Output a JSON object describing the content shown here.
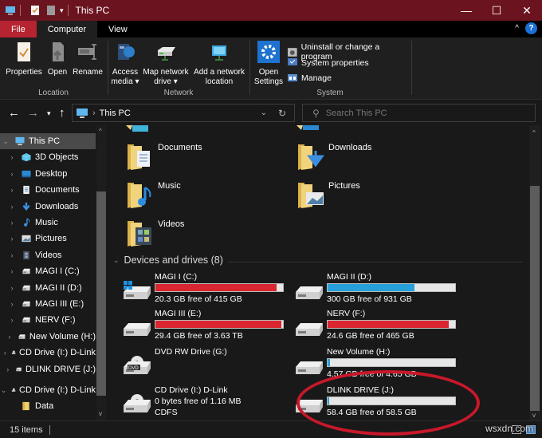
{
  "window": {
    "title": "This PC",
    "controls": {
      "minimize": "—",
      "maximize": "☐",
      "close": "✕"
    }
  },
  "ribbon_tabs": [
    {
      "label": "File"
    },
    {
      "label": "Computer",
      "active": true
    },
    {
      "label": "View"
    }
  ],
  "ribbon": {
    "groups": {
      "location": {
        "label": "Location",
        "buttons": [
          {
            "label": "Properties",
            "icon": "properties-icon"
          },
          {
            "label": "Open",
            "icon": "open-icon"
          },
          {
            "label": "Rename",
            "icon": "rename-icon"
          }
        ]
      },
      "network": {
        "label": "Network",
        "buttons": [
          {
            "label": "Access",
            "label2": "media ▾",
            "icon": "access-media-icon"
          },
          {
            "label": "Map network",
            "label2": "drive ▾",
            "icon": "map-network-drive-icon"
          },
          {
            "label": "Add a network",
            "label2": "location",
            "icon": "add-network-location-icon"
          }
        ]
      },
      "system": {
        "label": "System",
        "open_settings": {
          "label": "Open",
          "label2": "Settings"
        },
        "items": [
          {
            "label": "Uninstall or change a program"
          },
          {
            "label": "System properties"
          },
          {
            "label": "Manage"
          }
        ]
      }
    }
  },
  "address_bar": {
    "location": "This PC",
    "search_placeholder": "Search This PC"
  },
  "nav_pane": {
    "items": [
      {
        "label": "This PC",
        "selected": true,
        "expanded": true,
        "level": 0
      },
      {
        "label": "3D Objects",
        "level": 1
      },
      {
        "label": "Desktop",
        "level": 1
      },
      {
        "label": "Documents",
        "level": 1
      },
      {
        "label": "Downloads",
        "level": 1
      },
      {
        "label": "Music",
        "level": 1
      },
      {
        "label": "Pictures",
        "level": 1
      },
      {
        "label": "Videos",
        "level": 1
      },
      {
        "label": "MAGI I (C:)",
        "level": 1
      },
      {
        "label": "MAGI II (D:)",
        "level": 1
      },
      {
        "label": "MAGI III (E:)",
        "level": 1
      },
      {
        "label": "NERV (F:)",
        "level": 1
      },
      {
        "label": "New Volume (H:)",
        "level": 1
      },
      {
        "label": "CD Drive (I:) D-Link",
        "level": 1
      },
      {
        "label": "DLINK DRIVE (J:)",
        "level": 1
      },
      {
        "label": "CD Drive (I:) D-Link",
        "level": 0,
        "expanded": true
      },
      {
        "label": "Data",
        "level": 1
      }
    ]
  },
  "folders": [
    {
      "name": "Documents"
    },
    {
      "name": "Downloads"
    },
    {
      "name": "Music"
    },
    {
      "name": "Pictures"
    },
    {
      "name": "Videos"
    }
  ],
  "devices_section": {
    "header": "Devices and drives (8)"
  },
  "drives": [
    {
      "name": "MAGI I (C:)",
      "free": "20.3 GB free of 415 GB",
      "used_fraction": 0.95,
      "bar_color": "#da2630",
      "type": "system"
    },
    {
      "name": "MAGI II (D:)",
      "free": "300 GB free of 931 GB",
      "used_fraction": 0.68,
      "bar_color": "#26a0da",
      "type": "hdd"
    },
    {
      "name": "MAGI III (E:)",
      "free": "29.4 GB free of 3.63 TB",
      "used_fraction": 0.99,
      "bar_color": "#da2630",
      "type": "hdd"
    },
    {
      "name": "NERV (F:)",
      "free": "24.6 GB free of 465 GB",
      "used_fraction": 0.95,
      "bar_color": "#da2630",
      "type": "hdd"
    },
    {
      "name": "DVD RW Drive (G:)",
      "type": "dvd"
    },
    {
      "name": "New Volume (H:)",
      "free": "4.57 GB free of 4.65 GB",
      "used_fraction": 0.02,
      "bar_color": "#26a0da",
      "type": "hdd"
    },
    {
      "name": "CD Drive (I:) D-Link",
      "free": "0 bytes free of 1.16 MB",
      "filesystem": "CDFS",
      "type": "cd"
    },
    {
      "name": "DLINK DRIVE (J:)",
      "free": "58.4 GB free of 58.5 GB",
      "used_fraction": 0.002,
      "bar_color": "#26a0da",
      "type": "hdd"
    }
  ],
  "status_bar": {
    "item_count": "15 items"
  },
  "annotation": {
    "color": "#c8182a",
    "target": "DLINK DRIVE (J:)"
  },
  "watermark": "wsxdn.com"
}
